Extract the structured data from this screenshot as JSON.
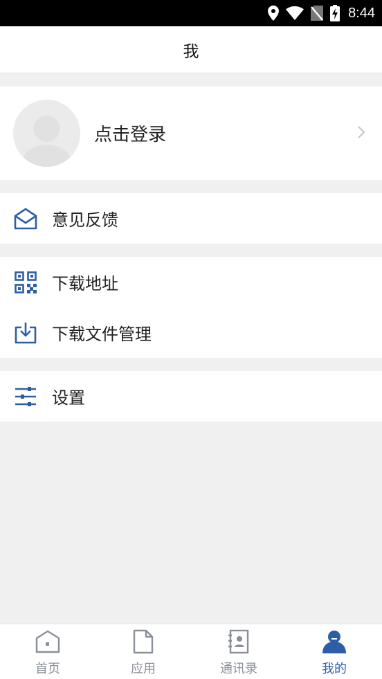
{
  "status_bar": {
    "time": "8:44"
  },
  "header": {
    "title": "我"
  },
  "profile": {
    "login_label": "点击登录"
  },
  "menu": {
    "feedback": "意见反馈",
    "download_address": "下载地址",
    "download_file_manager": "下载文件管理",
    "settings": "设置"
  },
  "tabs": [
    {
      "label": "首页",
      "icon": "home-icon",
      "active": false
    },
    {
      "label": "应用",
      "icon": "document-icon",
      "active": false
    },
    {
      "label": "通讯录",
      "icon": "contacts-icon",
      "active": false
    },
    {
      "label": "我的",
      "icon": "user-icon",
      "active": true
    }
  ],
  "colors": {
    "accent": "#2c5ea8",
    "inactive": "#8a8f99",
    "background": "#f0f0f0"
  }
}
